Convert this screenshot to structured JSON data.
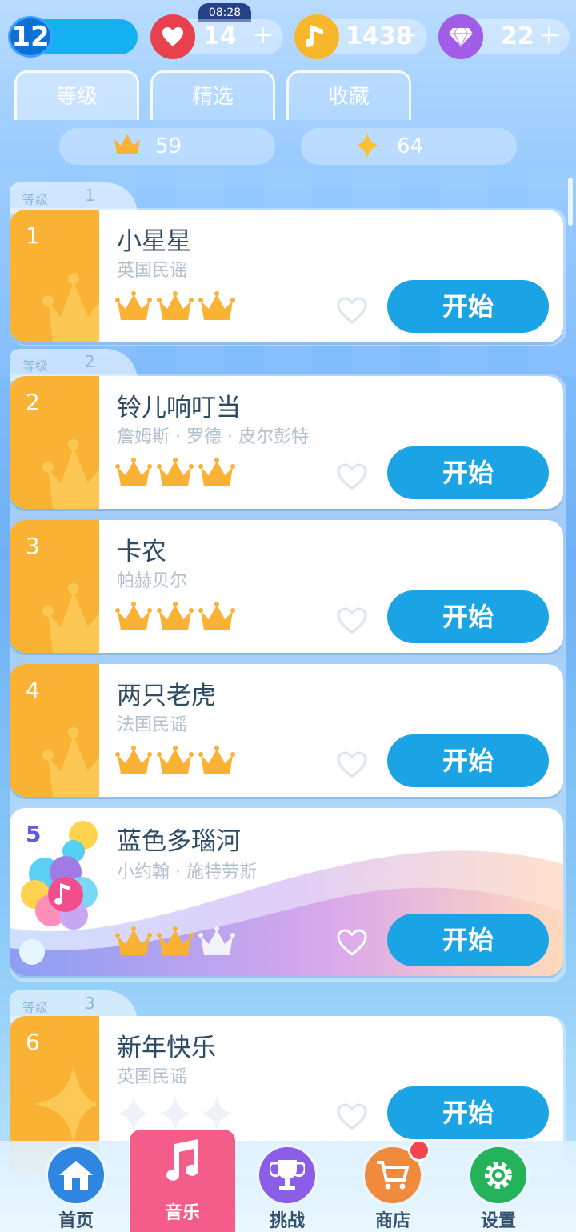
{
  "status": {
    "clock": "08:28",
    "level": "12",
    "hearts": "14",
    "notes": "1438",
    "gems": "22",
    "plus": "+"
  },
  "tabs": [
    {
      "label": "等级",
      "active": true
    },
    {
      "label": "精选",
      "active": false
    },
    {
      "label": "收藏",
      "active": false
    }
  ],
  "stats": {
    "crowns": "59",
    "stars": "64"
  },
  "grades": [
    {
      "label": "等级",
      "num": "1"
    },
    {
      "label": "等级",
      "num": "2"
    },
    {
      "label": "等级",
      "num": "3"
    }
  ],
  "songs": [
    {
      "index": "1",
      "title": "小星星",
      "artist": "英国民谣",
      "rating": [
        "gold",
        "gold",
        "gold"
      ],
      "start": "开始"
    },
    {
      "index": "2",
      "title": "铃儿响叮当",
      "artist": "詹姆斯 · 罗德 · 皮尔彭特",
      "rating": [
        "gold",
        "gold",
        "gold"
      ],
      "start": "开始"
    },
    {
      "index": "3",
      "title": "卡农",
      "artist": "帕赫贝尔",
      "rating": [
        "gold",
        "gold",
        "gold"
      ],
      "start": "开始"
    },
    {
      "index": "4",
      "title": "两只老虎",
      "artist": "法国民谣",
      "rating": [
        "gold",
        "gold",
        "gold"
      ],
      "start": "开始"
    },
    {
      "index": "5",
      "title": "蓝色多瑙河",
      "artist": "小约翰 · 施特劳斯",
      "rating": [
        "gold",
        "gold",
        "white"
      ],
      "start": "开始"
    },
    {
      "index": "6",
      "title": "新年快乐",
      "artist": "英国民谣",
      "rating": [
        "star-empty",
        "star-empty",
        "star-empty"
      ],
      "start": "开始"
    }
  ],
  "nav": [
    {
      "label": "首页",
      "icon": "home-icon"
    },
    {
      "label": "音乐",
      "icon": "music-note-icon"
    },
    {
      "label": "挑战",
      "icon": "trophy-icon"
    },
    {
      "label": "商店",
      "icon": "cart-icon"
    },
    {
      "label": "设置",
      "icon": "gear-icon"
    }
  ],
  "colors": {
    "accent": "#1ba4e5",
    "gold": "#f9b233",
    "music_tab": "#f45c8a"
  }
}
